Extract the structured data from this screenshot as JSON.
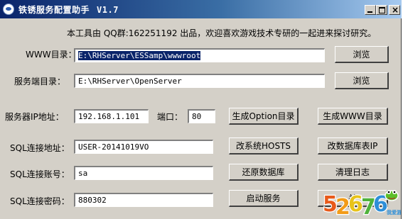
{
  "window": {
    "title": "铁锈服务配置助手",
    "version": "V1.7"
  },
  "intro": "本工具由 QQ群:162251192 出品，欢迎喜欢游戏技术专研的一起进来探讨研究。",
  "www_dir": {
    "label": "WWW目录：",
    "value": "E:\\RHServer\\ESSamp\\wwwroot",
    "browse_label": "浏览"
  },
  "server_dir": {
    "label": "服务端目录：",
    "value": "E:\\RHServer\\OpenServer",
    "browse_label": "浏览"
  },
  "server_ip": {
    "label": "服务器IP地址：",
    "value": "192.168.1.101"
  },
  "port": {
    "label": "端口：",
    "value": "80"
  },
  "sql_address": {
    "label": "SQL连接地址：",
    "value": "USER-20141019VO"
  },
  "sql_account": {
    "label": "SQL连接账号：",
    "value": "sa"
  },
  "sql_password": {
    "label": "SQL连接密码：",
    "value": "880302"
  },
  "buttons": {
    "gen_option_dir": "生成Option目录",
    "gen_www_dir": "生成WWW目录",
    "edit_hosts": "改系统HOSTS",
    "edit_db_ip": "改数据库表IP",
    "restore_db": "还原数据库",
    "clear_log": "清理日志",
    "start_service": "启动服务",
    "last_button_partial": "关"
  },
  "watermark": {
    "number": "52676",
    "text": "我爱游戏"
  }
}
